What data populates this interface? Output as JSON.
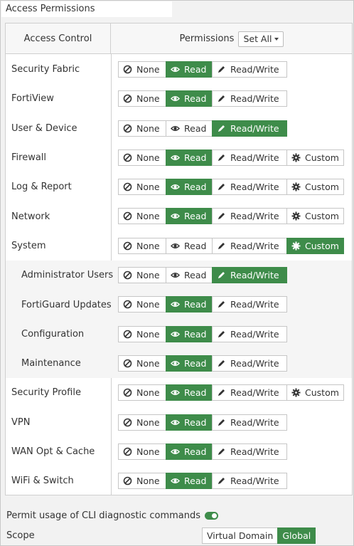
{
  "section_title": "Access Permissions",
  "header": {
    "access_control": "Access Control",
    "permissions": "Permissions",
    "set_all": "Set All"
  },
  "labels": {
    "none": "None",
    "read": "Read",
    "read_write": "Read/Write",
    "custom": "Custom"
  },
  "rows": [
    {
      "label": "Security Fabric",
      "selected": "read",
      "custom": false,
      "sub": false
    },
    {
      "label": "FortiView",
      "selected": "read",
      "custom": false,
      "sub": false
    },
    {
      "label": "User & Device",
      "selected": "read_write",
      "custom": false,
      "sub": false
    },
    {
      "label": "Firewall",
      "selected": "read",
      "custom": true,
      "sub": false
    },
    {
      "label": "Log & Report",
      "selected": "read",
      "custom": true,
      "sub": false
    },
    {
      "label": "Network",
      "selected": "read",
      "custom": true,
      "sub": false
    },
    {
      "label": "System",
      "selected": "custom",
      "custom": true,
      "sub": false
    },
    {
      "label": "Administrator Users",
      "selected": "read_write",
      "custom": false,
      "sub": true
    },
    {
      "label": "FortiGuard Updates",
      "selected": "read",
      "custom": false,
      "sub": true
    },
    {
      "label": "Configuration",
      "selected": "read",
      "custom": false,
      "sub": true
    },
    {
      "label": "Maintenance",
      "selected": "read",
      "custom": false,
      "sub": true
    },
    {
      "label": "Security Profile",
      "selected": "read",
      "custom": true,
      "sub": false
    },
    {
      "label": "VPN",
      "selected": "read",
      "custom": false,
      "sub": false
    },
    {
      "label": "WAN Opt & Cache",
      "selected": "read",
      "custom": false,
      "sub": false
    },
    {
      "label": "WiFi & Switch",
      "selected": "read",
      "custom": false,
      "sub": false
    }
  ],
  "cli": {
    "label": "Permit usage of CLI diagnostic commands",
    "enabled": true
  },
  "scope": {
    "label": "Scope",
    "options": [
      "Virtual Domain",
      "Global"
    ],
    "selected": "Global"
  },
  "colors": {
    "accent": "#3e8c4a"
  }
}
